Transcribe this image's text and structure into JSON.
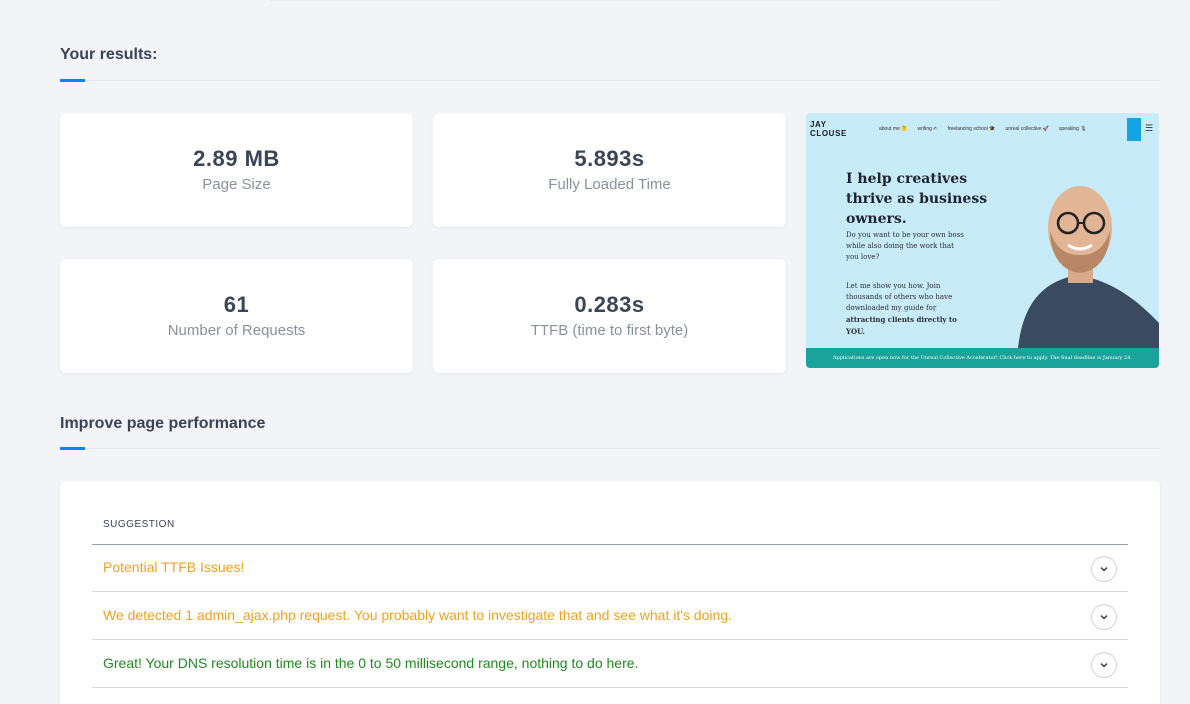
{
  "results": {
    "title": "Your results:",
    "stats": [
      {
        "value": "2.89 MB",
        "label": "Page Size"
      },
      {
        "value": "5.893s",
        "label": "Fully Loaded Time"
      },
      {
        "value": "61",
        "label": "Number of Requests"
      },
      {
        "value": "0.283s",
        "label": "TTFB (time to first byte)"
      }
    ]
  },
  "preview": {
    "logo_line1": "JAY",
    "logo_line2": "CLOUSE",
    "nav": [
      "about me 🤔",
      "writing ✍",
      "freelancing school 🎓",
      "unreal collective 🚀",
      "speaking 🎙"
    ],
    "headline": "I help creatives thrive as business owners.",
    "para1": "Do you want to be your own boss while also doing the work that you love?",
    "para2_start": "Let me show you how. Join thousands of others who have downloaded my guide for ",
    "para2_bold": "attracting clients directly to YOU.",
    "footer": "Applications are open now for the Unreal Collective Accelerator! Click here to apply. The final deadline is January 24."
  },
  "improve": {
    "title": "Improve page performance",
    "column_header": "SUGGESTION",
    "rows": [
      {
        "text": "Potential TTFB Issues!",
        "status": "warning"
      },
      {
        "text": "We detected 1 admin_ajax.php request. You probably want to investigate that and see what it's doing.",
        "status": "warning"
      },
      {
        "text": "Great! Your DNS resolution time is in the 0 to 50 millisecond range, nothing to do here.",
        "status": "good"
      }
    ]
  },
  "colors": {
    "accent": "#1a7fe6",
    "warning": "#f0a21e",
    "good": "#1f8a1f",
    "background": "#f2f4f8"
  },
  "icons": {
    "expand": "chevron-down-icon",
    "menu": "hamburger-icon"
  }
}
